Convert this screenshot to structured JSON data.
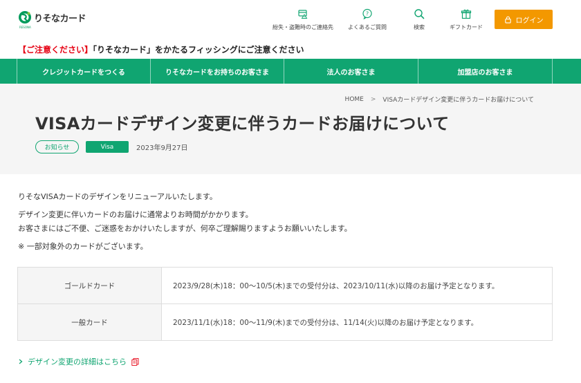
{
  "header": {
    "logo_text": "りそなカード",
    "logo_sub": "RESONA",
    "brand_green": "#009b5b",
    "utility": [
      {
        "label": "紛失・盗難時のご連絡先",
        "icon": "lost-card-icon"
      },
      {
        "label": "よくあるご質問",
        "icon": "faq-bubble-icon"
      },
      {
        "label": "検索",
        "icon": "search-icon"
      },
      {
        "label": "ギフトカード",
        "icon": "gift-icon"
      }
    ],
    "login_label": "ログイン",
    "login_color": "#f39800"
  },
  "alert": {
    "prefix": "【ご注意ください】",
    "message": "「りそなカード」をかたるフィッシングにご注意ください"
  },
  "gnav": {
    "color": "#10a571",
    "items": [
      "クレジットカードをつくる",
      "りそなカードをお持ちのお客さま",
      "法人のお客さま",
      "加盟店のお客さま"
    ]
  },
  "breadcrumb": {
    "home": "HOME",
    "separator": ">",
    "current": "VISAカードデザイン変更に伴うカードお届けについて"
  },
  "article": {
    "title": "VISAカードデザイン変更に伴うカードお届けについて",
    "tag_category": "お知らせ",
    "tag_brand": "Visa",
    "date": "2023年9月27日",
    "paragraphs": [
      "りそなVISAカードのデザインをリニューアルいたします。",
      "デザイン変更に伴いカードのお届けに通常よりお時間がかかります。",
      "お客さまにはご不便、ご迷惑をおかけいたしますが、何卒ご理解賜りますようお願いいたします。",
      "※ 一部対象外のカードがございます。"
    ],
    "table": [
      {
        "card": "ゴールドカード",
        "schedule": "2023/9/28(木)18：00～10/5(木)までの受付分は、2023/10/11(水)以降のお届け予定となります。"
      },
      {
        "card": "一般カード",
        "schedule": "2023/11/1(水)18：00～11/9(木)までの受付分は、11/14(火)以降のお届け予定となります。"
      }
    ],
    "detail_link": "デザイン変更の詳細はこちら"
  }
}
